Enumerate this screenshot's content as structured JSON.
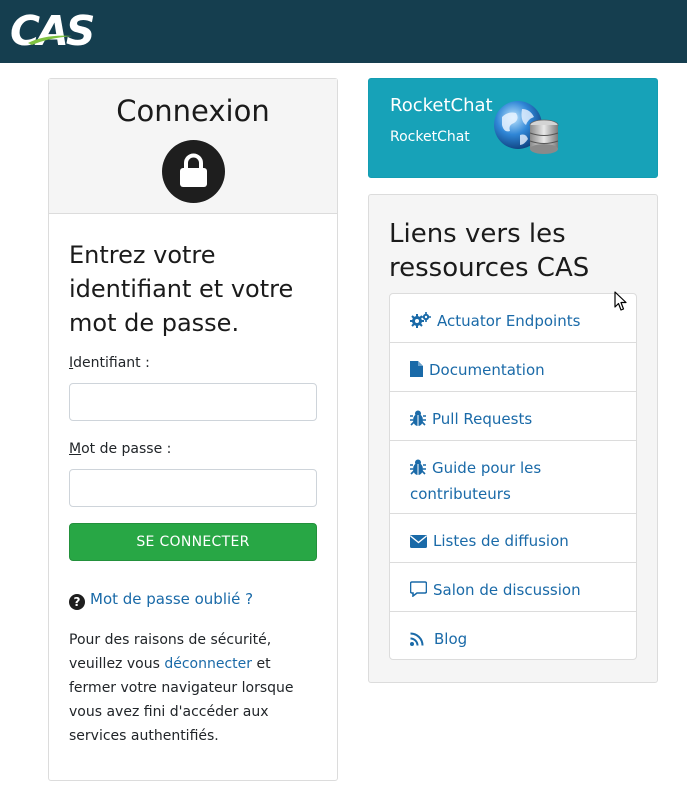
{
  "header": {
    "logo_text": "CAS",
    "colors": {
      "bar": "#153e4f",
      "swoosh": "#7fc241"
    }
  },
  "login": {
    "title": "Connexion",
    "heading": "Entrez votre identifiant et votre mot de passe.",
    "username_label_first": "I",
    "username_label_rest": "dentifiant :",
    "username_value": "",
    "password_label_first": "M",
    "password_label_rest": "ot de passe :",
    "password_value": "",
    "submit_label": "SE CONNECTER",
    "forgot_label": "Mot de passe oublié ?",
    "security_before": "Pour des raisons de sécurité, veuillez vous ",
    "security_link": "déconnecter",
    "security_after": " et fermer votre navigateur lorsque vous avez fini d'accéder aux services authentifiés.",
    "icons": {
      "header": "lock-icon",
      "forgot": "question-circle-icon"
    },
    "colors": {
      "submit": "#28a745",
      "link": "#1a6aa8"
    }
  },
  "rocketchat": {
    "title": "RocketChat",
    "subtitle": "RocketChat",
    "icon": "globe-database-icon",
    "color": "#17a2b8"
  },
  "resources": {
    "title": "Liens vers les ressources CAS",
    "links": [
      {
        "label": "Actuator Endpoints",
        "icon": "gears-icon"
      },
      {
        "label": "Documentation",
        "icon": "file-icon"
      },
      {
        "label": "Pull Requests",
        "icon": "bug-icon"
      },
      {
        "label": "Guide pour les contributeurs",
        "icon": "bug-icon"
      },
      {
        "label": "Listes de diffusion",
        "icon": "envelope-icon"
      },
      {
        "label": "Salon de discussion",
        "icon": "comment-icon"
      },
      {
        "label": "Blog",
        "icon": "rss-icon"
      }
    ]
  }
}
